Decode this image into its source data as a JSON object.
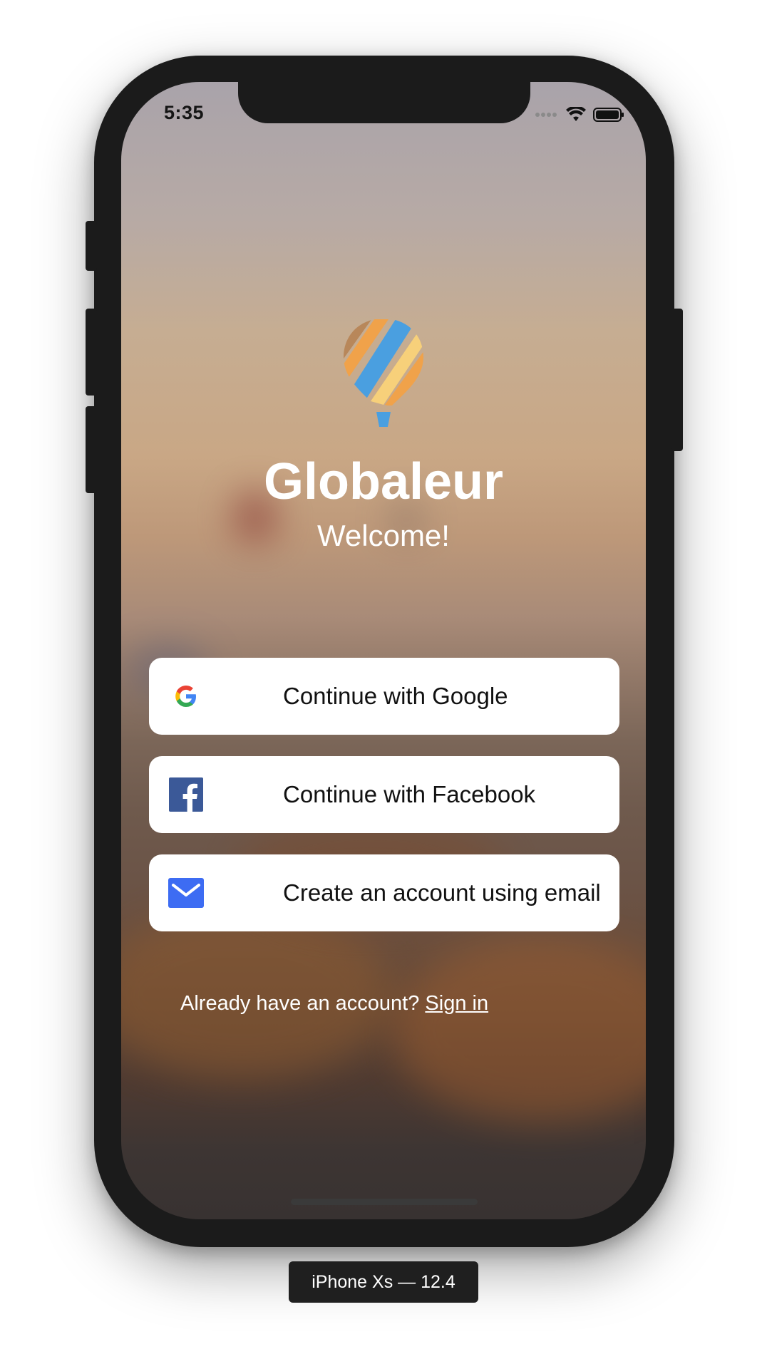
{
  "status_bar": {
    "time": "5:35",
    "icons": [
      "signal-dots-icon",
      "wifi-icon",
      "battery-icon"
    ]
  },
  "app": {
    "name": "Globaleur",
    "greeting": "Welcome!",
    "logo_icon": "hot-air-balloon-icon"
  },
  "auth_options": {
    "google_label": "Continue with Google",
    "google_icon": "google-icon",
    "facebook_label": "Continue with Facebook",
    "facebook_icon": "facebook-icon",
    "email_label": "Create an account using email",
    "email_icon": "mail-icon"
  },
  "signin": {
    "prompt": "Already have an account?",
    "link": "Sign in"
  },
  "device_label": "iPhone Xs — 12.4",
  "colors": {
    "facebook_blue": "#3b5998",
    "mail_blue": "#3d6cf3",
    "balloon_blue": "#4a9fe0",
    "balloon_orange": "#f0a24a",
    "balloon_yellow": "#f7d07a",
    "button_bg": "#ffffff"
  }
}
